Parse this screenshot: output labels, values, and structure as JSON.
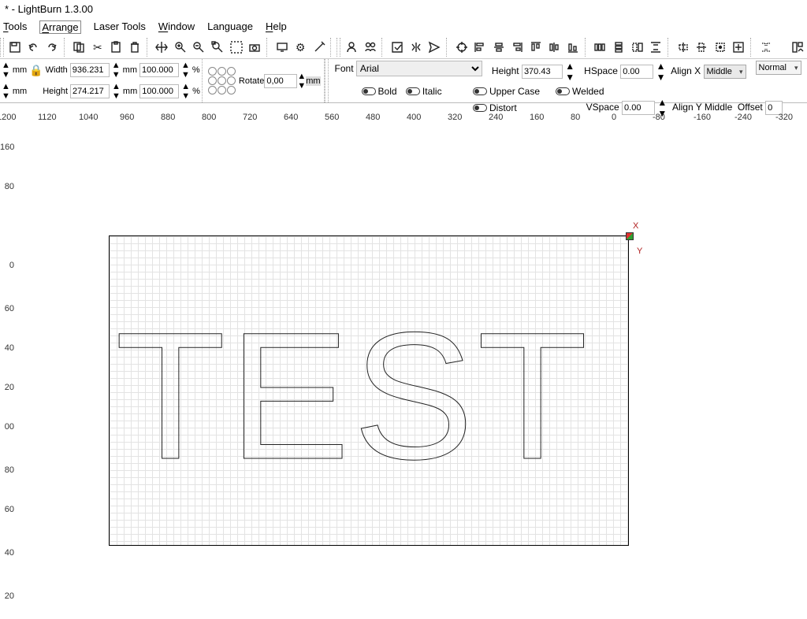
{
  "title": " * - LightBurn 1.3.00",
  "menu": {
    "tools": "Tools",
    "arrange": "Arrange",
    "laser": "Laser Tools",
    "window": "Window",
    "language": "Language",
    "help": "Help"
  },
  "size": {
    "width_label": "Width",
    "width_val": "936.231",
    "width_unit": "mm",
    "width_pct": "100.000",
    "pct": "%",
    "height_label": "Height",
    "height_val": "274.217",
    "height_unit": "mm",
    "height_pct": "100.000",
    "mm": "mm"
  },
  "rotate": {
    "label": "Rotate",
    "val": "0,00",
    "mm": "mm"
  },
  "font": {
    "label": "Font",
    "name": "Arial",
    "height_label": "Height",
    "height_val": "370.43",
    "bold": "Bold",
    "upper": "Upper Case",
    "welded": "Welded",
    "italic": "Italic",
    "distort": "Distort",
    "hspace_label": "HSpace",
    "hspace_val": "0.00",
    "alignx_label": "Align X",
    "alignx_val": "Middle",
    "normal": "Normal",
    "vspace_label": "VSpace",
    "vspace_val": "0.00",
    "aligny_label": "Align Y",
    "aligny_val": "Middle",
    "offset_label": "Offset",
    "offset_val": "0"
  },
  "rulerH": [
    "1200",
    "1120",
    "1040",
    "960",
    "880",
    "800",
    "720",
    "640",
    "560",
    "480",
    "400",
    "320",
    "240",
    "160",
    "80",
    "0",
    "-80",
    "-160",
    "-240",
    "-320"
  ],
  "rulerV": [
    "160",
    "80",
    "0",
    "60",
    "40",
    "20",
    "00",
    "80",
    "60",
    "40",
    "20"
  ],
  "origin": {
    "x": "X",
    "y": "Y"
  },
  "canvasText": "TEST"
}
